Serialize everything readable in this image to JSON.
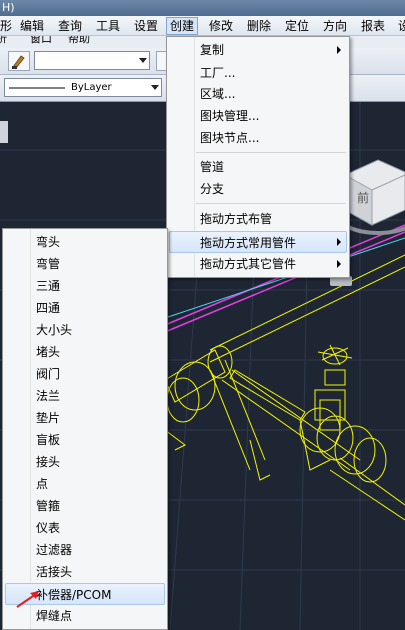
{
  "window": {
    "title_fragment": "H)"
  },
  "menubar": {
    "items": [
      "形",
      "编辑",
      "查询",
      "工具",
      "设置",
      "创建",
      "修改",
      "删除",
      "定位",
      "方向",
      "报表",
      "设"
    ],
    "active_index": 5
  },
  "menubar2": {
    "items": [
      "析",
      "窗口",
      "帮助"
    ]
  },
  "toolbar": {
    "linetype_value": "ByLayer"
  },
  "viewcube": {
    "face_label": "前"
  },
  "create_menu": {
    "items": [
      {
        "label": "复制",
        "submenu": true
      },
      {
        "label": "工厂...",
        "submenu": false
      },
      {
        "label": "区域...",
        "submenu": false
      },
      {
        "label": "图块管理...",
        "submenu": false
      },
      {
        "label": "图块节点...",
        "submenu": false
      },
      {
        "label": "管道",
        "submenu": false
      },
      {
        "label": "分支",
        "submenu": false
      },
      {
        "label": "拖动方式布管",
        "submenu": false
      },
      {
        "label": "拖动方式常用管件",
        "submenu": true
      },
      {
        "label": "拖动方式其它管件",
        "submenu": true
      }
    ],
    "highlighted_index": 8
  },
  "fittings_menu": {
    "items": [
      "弯头",
      "弯管",
      "三通",
      "四通",
      "大小头",
      "堵头",
      "阀门",
      "法兰",
      "垫片",
      "盲板",
      "接头",
      "点",
      "管箍",
      "仪表",
      "过滤器",
      "活接头",
      "补偿器/PCOM",
      "焊缝点"
    ],
    "highlighted_index": 16
  },
  "colors": {
    "background": "#1e2634",
    "pipe": "#f5f500",
    "magenta_line": "#e040e0",
    "cyan_line": "#48d8f0",
    "menu_highlight": "#d6e6fa"
  }
}
